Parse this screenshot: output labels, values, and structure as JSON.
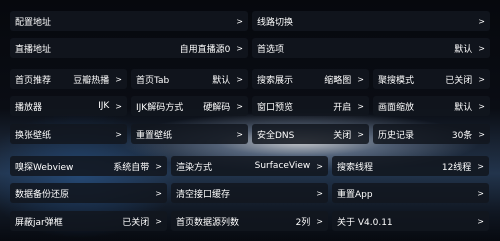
{
  "rows": [
    [
      {
        "label": "配置地址",
        "value": ""
      },
      {
        "label": "线路切换",
        "value": ""
      }
    ],
    [
      {
        "label": "直播地址",
        "value": "自用直播源0"
      },
      {
        "label": "首选项",
        "value": "默认"
      }
    ],
    [
      {
        "label": "首页推荐",
        "value": "豆瓣热播"
      },
      {
        "label": "首页Tab",
        "value": "默认"
      },
      {
        "label": "搜索展示",
        "value": "缩略图"
      },
      {
        "label": "聚搜模式",
        "value": "已关闭"
      }
    ],
    [
      {
        "label": "播放器",
        "value": "IJK"
      },
      {
        "label": "IJK解码方式",
        "value": "硬解码"
      },
      {
        "label": "窗口预览",
        "value": "开启"
      },
      {
        "label": "画面缩放",
        "value": "默认"
      }
    ],
    [
      {
        "label": "换张壁纸",
        "value": ""
      },
      {
        "label": "重置壁纸",
        "value": ""
      },
      {
        "label": "安全DNS",
        "value": "关闭"
      },
      {
        "label": "历史记录",
        "value": "30条"
      }
    ],
    [
      {
        "label": "嗅探Webview",
        "value": "系统自带"
      },
      {
        "label": "渲染方式",
        "value": "SurfaceView"
      },
      {
        "label": "搜索线程",
        "value": "12线程"
      }
    ],
    [
      {
        "label": "数据备份还原",
        "value": ""
      },
      {
        "label": "清空接口缓存",
        "value": ""
      },
      {
        "label": "重置App",
        "value": ""
      }
    ],
    [
      {
        "label": "屏蔽jar弹框",
        "value": "已关闭"
      },
      {
        "label": "首页数据源列数",
        "value": "2列"
      },
      {
        "label": "关于  V4.0.11",
        "value": ""
      }
    ]
  ],
  "arrow_glyph": ">"
}
